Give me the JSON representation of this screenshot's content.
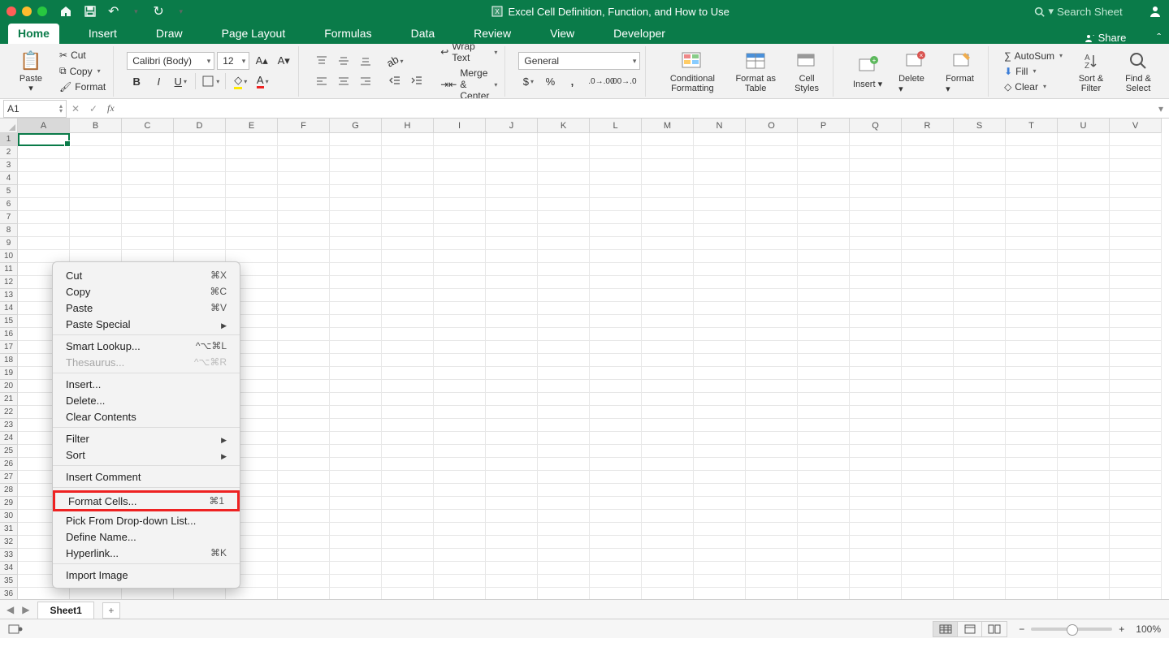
{
  "title": "Excel Cell Definition, Function, and How to Use",
  "search_placeholder": "Search Sheet",
  "share_label": "Share",
  "tabs": [
    "Home",
    "Insert",
    "Draw",
    "Page Layout",
    "Formulas",
    "Data",
    "Review",
    "View",
    "Developer"
  ],
  "active_tab_index": 0,
  "clipboard": {
    "paste": "Paste",
    "cut": "Cut",
    "copy": "Copy",
    "format": "Format"
  },
  "font": {
    "name": "Calibri (Body)",
    "size": "12"
  },
  "alignment": {
    "wrap": "Wrap Text",
    "merge": "Merge & Center"
  },
  "number": {
    "format": "General"
  },
  "styles": {
    "cf": "Conditional Formatting",
    "fat": "Format as Table",
    "cs": "Cell Styles"
  },
  "cells": {
    "insert": "Insert",
    "delete": "Delete",
    "format": "Format"
  },
  "editing": {
    "autosum": "AutoSum",
    "fill": "Fill",
    "clear": "Clear",
    "sort": "Sort & Filter",
    "find": "Find & Select"
  },
  "namebox": "A1",
  "columns": [
    "A",
    "B",
    "C",
    "D",
    "E",
    "F",
    "G",
    "H",
    "I",
    "J",
    "K",
    "L",
    "M",
    "N",
    "O",
    "P",
    "Q",
    "R",
    "S",
    "T",
    "U",
    "V"
  ],
  "row_count": 36,
  "context_menu": {
    "cut": "Cut",
    "cut_sc": "⌘X",
    "copy": "Copy",
    "copy_sc": "⌘C",
    "paste": "Paste",
    "paste_sc": "⌘V",
    "paste_special": "Paste Special",
    "smart": "Smart Lookup...",
    "smart_sc": "^⌥⌘L",
    "thesaurus": "Thesaurus...",
    "thesaurus_sc": "^⌥⌘R",
    "insert": "Insert...",
    "delete": "Delete...",
    "clear": "Clear Contents",
    "filter": "Filter",
    "sort": "Sort",
    "comment": "Insert Comment",
    "format_cells": "Format Cells...",
    "format_cells_sc": "⌘1",
    "pick": "Pick From Drop-down List...",
    "define": "Define Name...",
    "hyperlink": "Hyperlink...",
    "hyperlink_sc": "⌘K",
    "import": "Import Image"
  },
  "sheet_name": "Sheet1",
  "zoom": "100%"
}
